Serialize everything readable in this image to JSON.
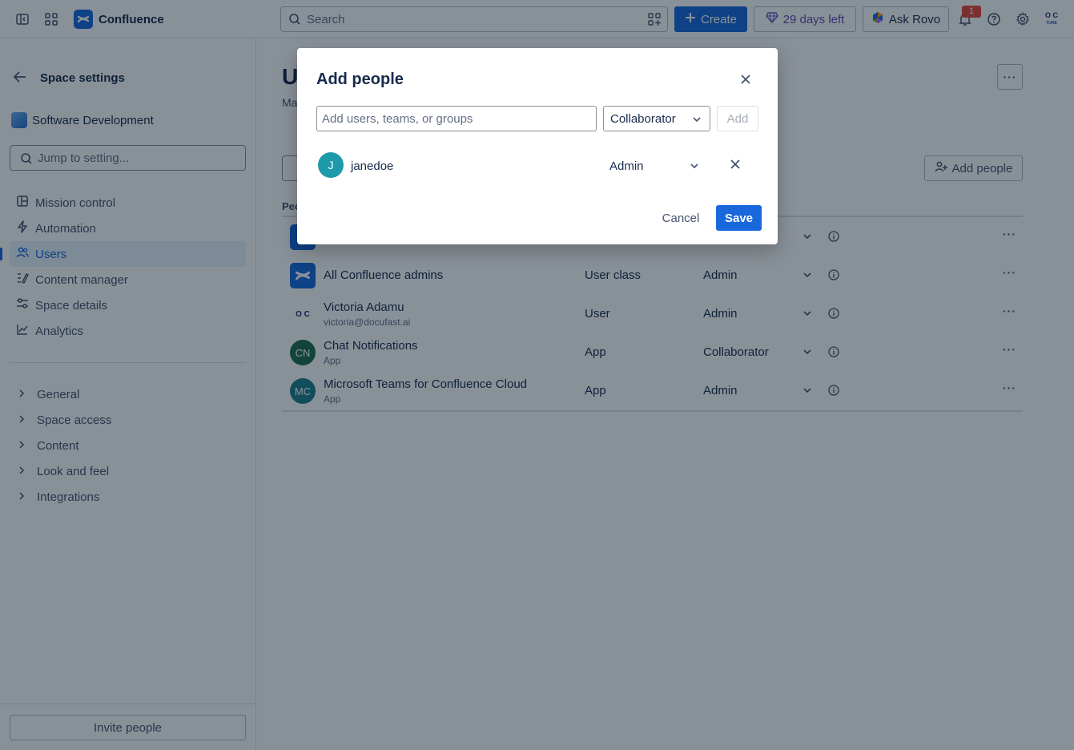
{
  "app": {
    "name": "Confluence"
  },
  "topbar": {
    "search_placeholder": "Search",
    "create_label": "Create",
    "trial_label": "29 days left",
    "rovo_label": "Ask Rovo",
    "notification_count": "1",
    "avatar_initials": "O C",
    "avatar_sub": "TURE"
  },
  "sidebar": {
    "back_title": "Space settings",
    "space_name": "Software Development",
    "jump_placeholder": "Jump to setting...",
    "items": [
      {
        "label": "Mission control",
        "icon": "grid-icon"
      },
      {
        "label": "Automation",
        "icon": "lightning-icon"
      },
      {
        "label": "Users",
        "icon": "people-icon",
        "active": true
      },
      {
        "label": "Content manager",
        "icon": "content-icon"
      },
      {
        "label": "Space details",
        "icon": "sliders-icon"
      },
      {
        "label": "Analytics",
        "icon": "chart-icon"
      }
    ],
    "groups": [
      "General",
      "Space access",
      "Content",
      "Look and feel",
      "Integrations"
    ],
    "invite_label": "Invite people"
  },
  "main": {
    "title_fragment": "U",
    "subtitle_fragment": "Ma",
    "add_people_label": "Add people",
    "table_header_fragment": "Peo",
    "rows": [
      {
        "name": "",
        "type": "",
        "role": "",
        "avatar": "confluence"
      },
      {
        "name": "All Confluence admins",
        "sub": "",
        "type": "User class",
        "role": "Admin",
        "avatar": "confluence"
      },
      {
        "name": "Victoria Adamu",
        "sub": "victoria@docufast.ai",
        "type": "User",
        "role": "Admin",
        "avatar": "logo"
      },
      {
        "name": "Chat Notifications",
        "sub": "App",
        "type": "App",
        "role": "Collaborator",
        "avatar": "CN",
        "color": "#216e4e"
      },
      {
        "name": "Microsoft Teams for Confluence Cloud",
        "sub": "App",
        "type": "App",
        "role": "Admin",
        "avatar": "MC",
        "color": "#1d7f8c"
      }
    ]
  },
  "modal": {
    "title": "Add people",
    "input_placeholder": "Add users, teams, or groups",
    "role_select": "Collaborator",
    "add_label": "Add",
    "pending_user": {
      "initial": "J",
      "name": "janedoe",
      "role": "Admin"
    },
    "cancel_label": "Cancel",
    "save_label": "Save"
  },
  "colors": {
    "brand": "#1868db",
    "overlay": "rgba(5,21,36,0.47)"
  }
}
